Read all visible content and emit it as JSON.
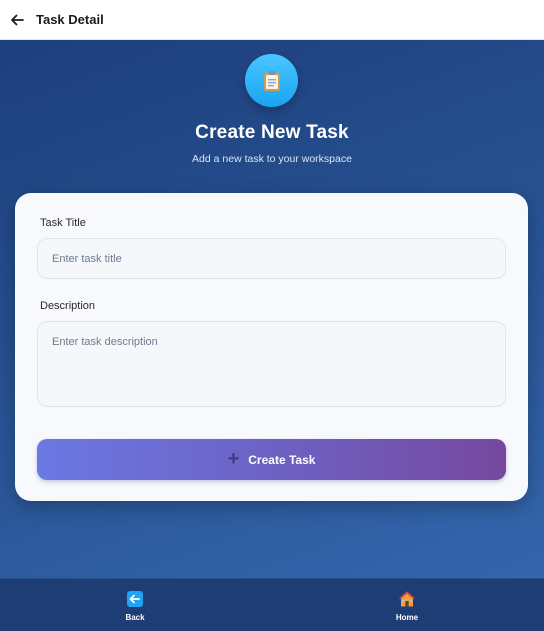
{
  "appbar": {
    "title": "Task Detail"
  },
  "hero": {
    "title": "Create New Task",
    "subtitle": "Add a new task to your workspace",
    "icon": "clipboard-icon"
  },
  "form": {
    "title_label": "Task Title",
    "title_placeholder": "Enter task title",
    "title_value": "",
    "description_label": "Description",
    "description_placeholder": "Enter task description",
    "description_value": "",
    "submit_label": "Create Task"
  },
  "bottom_nav": {
    "items": [
      {
        "label": "Back",
        "icon": "back-arrow-icon"
      },
      {
        "label": "Home",
        "icon": "home-icon"
      }
    ]
  },
  "colors": {
    "background_gradient": [
      "#1e3f7d",
      "#3466ad"
    ],
    "hero_icon": "#17a6f2",
    "button_gradient": [
      "#6b78e3",
      "#76489f"
    ],
    "bottom_nav": "#1f3d75"
  }
}
